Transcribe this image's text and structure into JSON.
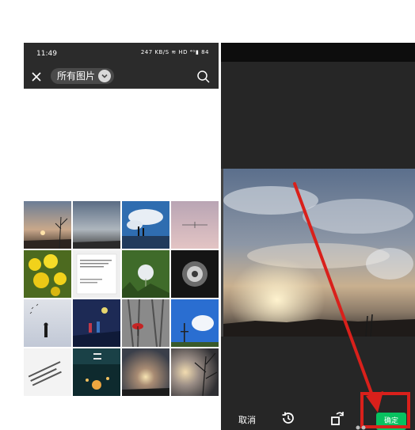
{
  "status_bar": {
    "time": "11:49",
    "indicators": "247 KB/S  ≋ HD ⁴ᴳ▮ 84"
  },
  "header": {
    "album_label": "所有图片",
    "close_icon": "close-icon",
    "search_icon": "search-icon"
  },
  "editor": {
    "cancel_label": "取消",
    "confirm_label": "确定",
    "reset_icon": "history-icon",
    "rotate_icon": "rotate-icon"
  },
  "colors": {
    "confirm": "#07c160",
    "highlight": "#d9201b",
    "dark_bg": "#262626"
  }
}
